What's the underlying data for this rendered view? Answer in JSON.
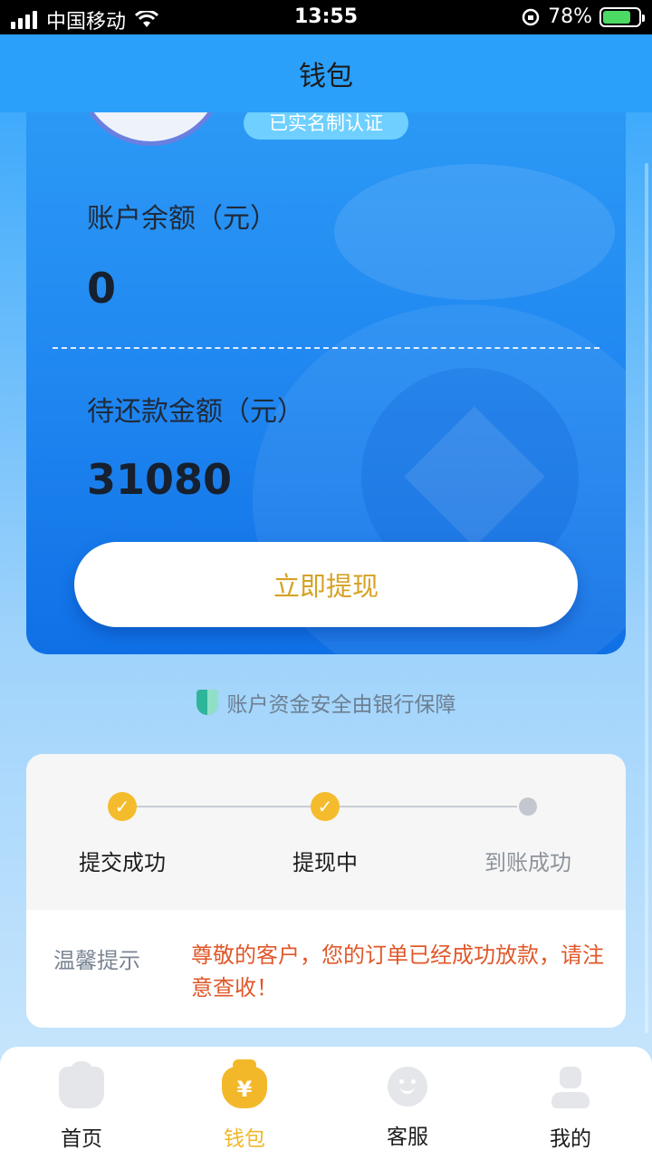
{
  "status_bar": {
    "carrier": "中国移动",
    "time": "13:55",
    "battery_percent": "78%",
    "battery_level": 0.78
  },
  "header": {
    "title": "钱包"
  },
  "wallet": {
    "verified_badge": "已实名制认证",
    "balance_label": "账户余额（元）",
    "balance_value": "0",
    "repay_label": "待还款金额（元）",
    "repay_value": "31080",
    "withdraw_button": "立即提现"
  },
  "security_note": "账户资金安全由银行保障",
  "progress": {
    "steps": [
      {
        "label": "提交成功",
        "status": "done"
      },
      {
        "label": "提现中",
        "status": "done"
      },
      {
        "label": "到账成功",
        "status": "pending"
      }
    ],
    "tip_title": "温馨提示",
    "tip_message": "尊敬的客户，您的订单已经成功放款，请注意查收！"
  },
  "tabbar": {
    "items": [
      {
        "label": "首页",
        "icon": "home-icon",
        "active": false
      },
      {
        "label": "钱包",
        "icon": "wallet-icon",
        "active": true
      },
      {
        "label": "客服",
        "icon": "service-icon",
        "active": false
      },
      {
        "label": "我的",
        "icon": "profile-icon",
        "active": false
      }
    ]
  },
  "colors": {
    "primary_blue": "#1f86f0",
    "accent_gold": "#f3b82a",
    "warning_red": "#e0582a"
  }
}
